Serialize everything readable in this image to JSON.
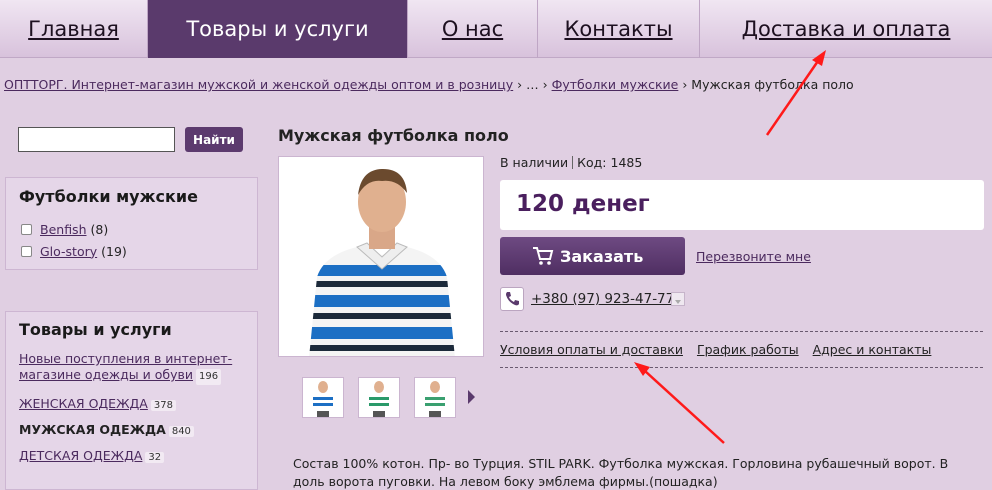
{
  "nav": {
    "items": [
      {
        "label": "Главная"
      },
      {
        "label": "Товары и услуги"
      },
      {
        "label": "О нас"
      },
      {
        "label": "Контакты"
      },
      {
        "label": "Доставка и оплата"
      }
    ]
  },
  "breadcrumb": {
    "home": "ОПТТОРГ. Интернет-магазин мужской и женской одежды оптом и в розницу",
    "sep1": " › … › ",
    "category": "Футболки мужские",
    "sep2": " › ",
    "current": "Мужская футболка поло"
  },
  "search": {
    "button_label": "Найти",
    "value": ""
  },
  "filter": {
    "title": "Футболки мужские",
    "items": [
      {
        "label": "Benfish",
        "count": "(8)"
      },
      {
        "label": "Glo-story",
        "count": "(19)"
      }
    ]
  },
  "categories": {
    "title": "Товары и услуги",
    "items": [
      {
        "label": "Новые поступления в интернет-магазине одежды и обуви",
        "count": "196"
      },
      {
        "label": "ЖЕНСКАЯ ОДЕЖДА",
        "count": "378"
      },
      {
        "label": "МУЖСКАЯ ОДЕЖДА",
        "count": "840"
      },
      {
        "label": "ДЕТСКАЯ ОДЕЖДА",
        "count": "32"
      }
    ]
  },
  "product": {
    "title": "Мужская футболка поло",
    "availability": "В наличии",
    "code": "Код: 1485",
    "price": "120 денег",
    "order_label": "Заказать",
    "callback_label": "Перезвоните мне",
    "phone": "+380 (97) 923-47-77",
    "links": [
      "Условия оплаты и доставки",
      "График работы",
      "Адрес и контакты"
    ],
    "description": "Состав 100% котон. Пр- во Турция. STIL PARK. Футболка мужская. Горловина рубашечный ворот. В доль ворота пуговки. На левом боку эмблема фирмы.(пошадка)"
  },
  "colors": {
    "accent": "#5a3a6c",
    "background": "#e0cfe2",
    "price": "#4a1f5e"
  }
}
